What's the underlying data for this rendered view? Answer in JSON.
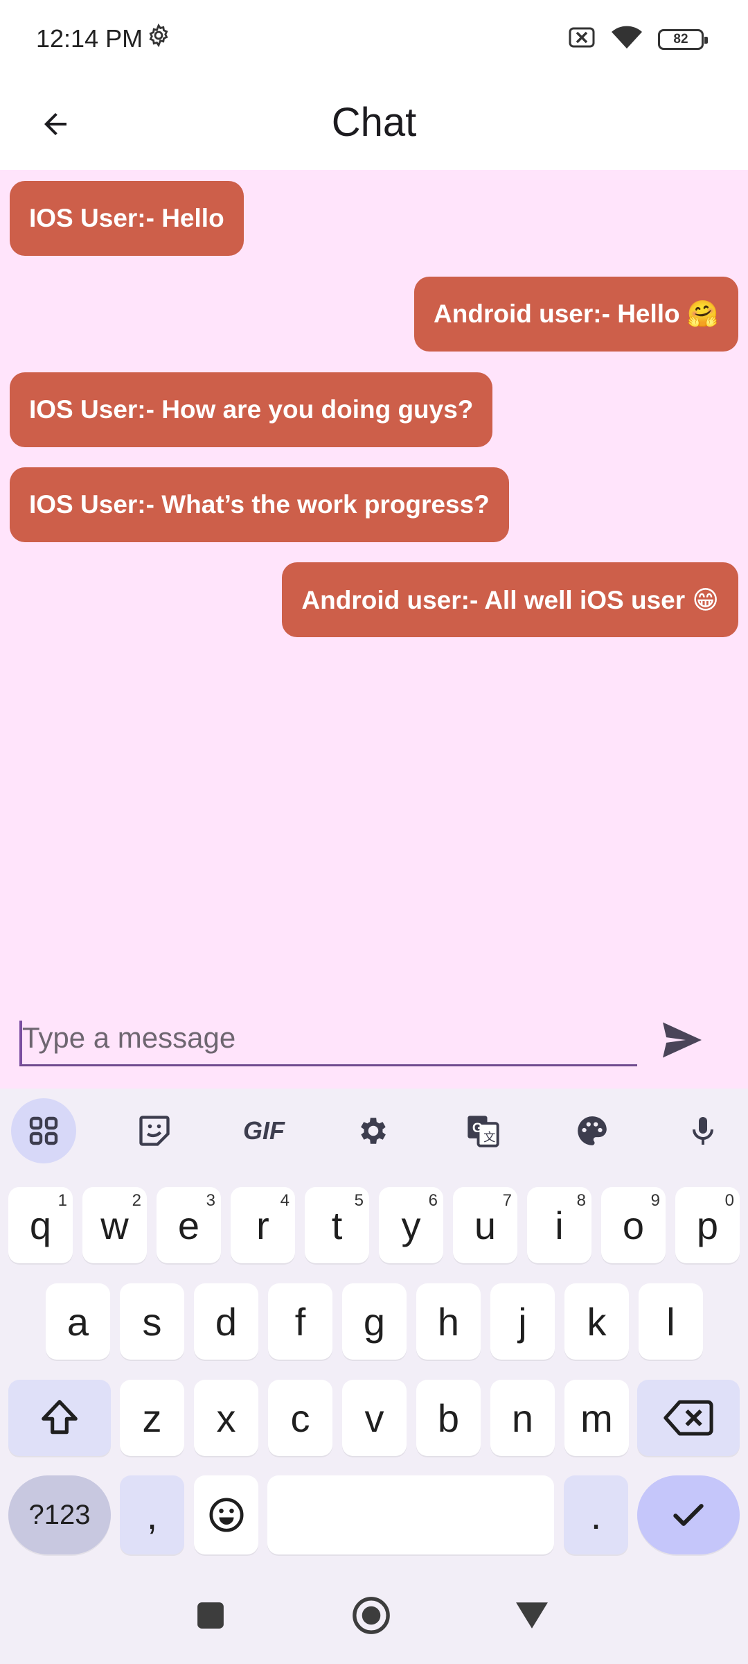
{
  "status_bar": {
    "time": "12:14 PM",
    "battery": "82"
  },
  "app_bar": {
    "title": "Chat"
  },
  "colors": {
    "chat_background": "#ffe4fb",
    "bubble": "#cd5f4a",
    "bubble_text": "#ffffff",
    "accent": "#7a4ea0"
  },
  "messages": [
    {
      "side": "left",
      "text": "IOS User:- Hello"
    },
    {
      "side": "right",
      "text": "Android user:- Hello 🤗"
    },
    {
      "side": "left",
      "text": "IOS User:- How are you doing guys?"
    },
    {
      "side": "left",
      "text": "IOS User:- What’s the work progress?"
    },
    {
      "side": "right",
      "text": "Android user:- All well iOS user 😁"
    }
  ],
  "input": {
    "placeholder": "Type a message",
    "value": ""
  },
  "keyboard": {
    "toolbar": [
      "apps-grid-icon",
      "sticker-icon",
      "GIF",
      "settings-icon",
      "translate-icon",
      "palette-icon",
      "microphone-icon"
    ],
    "gif_label": "GIF",
    "row1": [
      "q",
      "w",
      "e",
      "r",
      "t",
      "y",
      "u",
      "i",
      "o",
      "p"
    ],
    "row1_hints": [
      "1",
      "2",
      "3",
      "4",
      "5",
      "6",
      "7",
      "8",
      "9",
      "0"
    ],
    "row2": [
      "a",
      "s",
      "d",
      "f",
      "g",
      "h",
      "j",
      "k",
      "l"
    ],
    "row3": [
      "z",
      "x",
      "c",
      "v",
      "b",
      "n",
      "m"
    ],
    "symbols_label": "?123",
    "comma_label": ",",
    "period_label": "."
  }
}
